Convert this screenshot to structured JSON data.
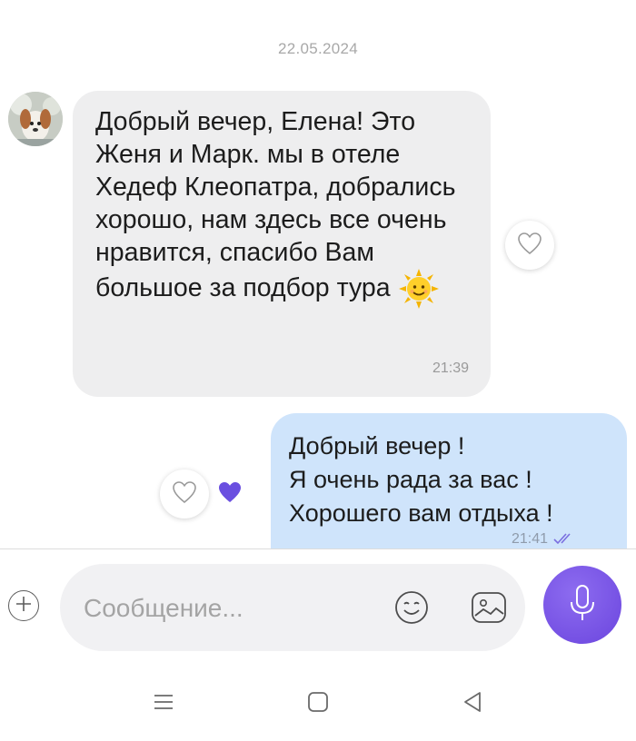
{
  "chat": {
    "date": "22.05.2024",
    "messages": [
      {
        "direction": "incoming",
        "text": "Добрый вечер, Елена! Это Женя и Марк. мы в отеле Хедеф Клеопатра, добрались хорошо, нам здесь все очень нравится, спасибо Вам большое за подбор тура",
        "emoji": "sun-with-face",
        "time": "21:39",
        "reaction": "heart-outline"
      },
      {
        "direction": "outgoing",
        "lines": [
          "Добрый вечер !",
          "Я очень рада за вас !",
          "Хорошего вам отдыха !"
        ],
        "time": "21:41",
        "status": "read-double-check",
        "reaction": "heart-filled"
      }
    ]
  },
  "composer": {
    "placeholder": "Сообщение...",
    "value": ""
  },
  "colors": {
    "incoming_bubble": "#eeeeef",
    "outgoing_bubble": "#cfe4fb",
    "accent": "#7353e5",
    "timestamp": "#9a9a9a"
  },
  "icons": {
    "attach": "plus-icon",
    "emoji": "smiley-icon",
    "gallery": "gallery-icon",
    "voice": "microphone-icon",
    "nav_recent": "menu-icon",
    "nav_home": "home-icon",
    "nav_back": "back-icon"
  }
}
